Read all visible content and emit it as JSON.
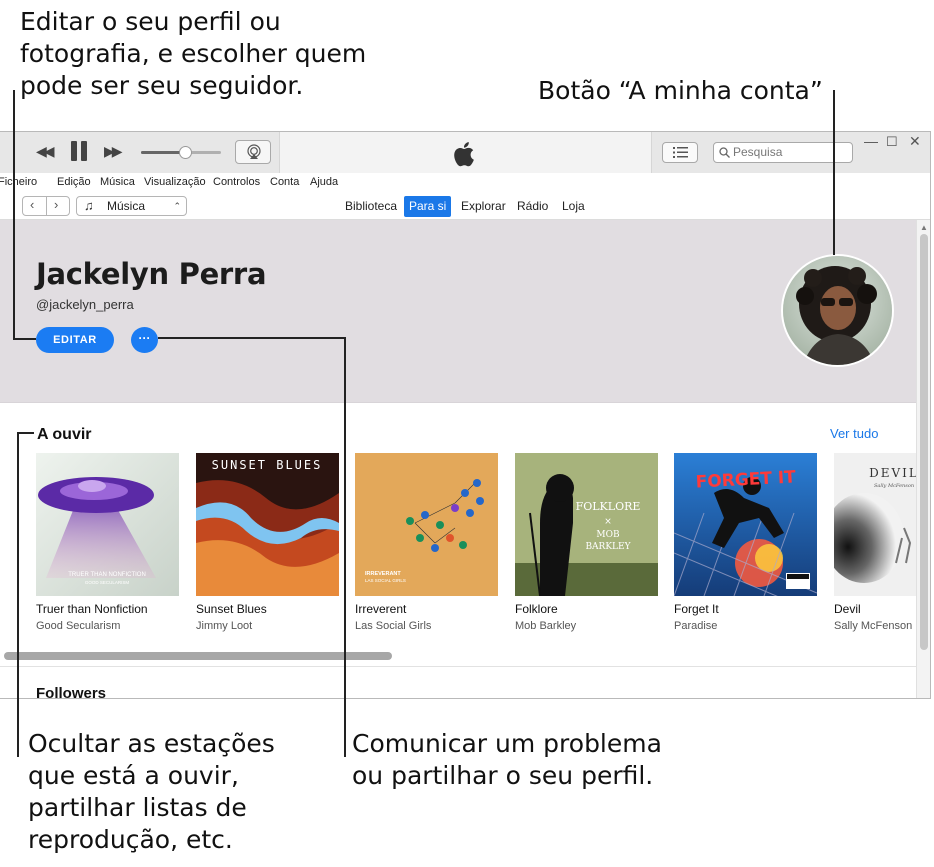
{
  "callouts": {
    "profile_edit": "Editar o seu perfil ou\nfotografia, e escolher quem\npode ser seu seguidor.",
    "account_button": "Botão “A minha conta”",
    "hide_stations": "Ocultar as estações\nque está a ouvir,\npartilhar listas de\nreprodução, etc.",
    "report_share": "Comunicar um problema\nou partilhar o seu perfil."
  },
  "window": {
    "search_placeholder": "Pesquisa",
    "menu": [
      "Ficheiro",
      "Edição",
      "Música",
      "Visualização",
      "Controlos",
      "Conta",
      "Ajuda"
    ],
    "source_label": "Música",
    "tabs": [
      "Biblioteca",
      "Para si",
      "Explorar",
      "Rádio",
      "Loja"
    ],
    "active_tab": "Para si",
    "volume_level": 0.55
  },
  "profile": {
    "name": "Jackelyn Perra",
    "handle": "@jackelyn_perra",
    "edit_label": "EDITAR",
    "more_label": "···"
  },
  "listening": {
    "title": "A ouvir",
    "see_all": "Ver tudo",
    "albums": [
      {
        "title": "Truer than Nonfiction",
        "artist": "Good Secularism",
        "cover_text": "TRUER THAN NONFICTION\nGOOD SECULARISM"
      },
      {
        "title": "Sunset Blues",
        "artist": "Jimmy Loot",
        "cover_text": "SUNSET BLUES"
      },
      {
        "title": "Irreverent",
        "artist": "Las Social Girls",
        "cover_text": "IRREVERANT\nLAS SOCIAL GIRLS"
      },
      {
        "title": "Folklore",
        "artist": "Mob Barkley",
        "cover_text": "FOLKLORE\n×\nMOB\nBARKLEY"
      },
      {
        "title": "Forget It",
        "artist": "Paradise",
        "cover_text": "FORGET IT"
      },
      {
        "title": "Devil",
        "artist": "Sally McFenson",
        "cover_text": "DEVIL\nSally McFenson"
      }
    ]
  },
  "followers_title": "Followers",
  "colors": {
    "accent": "#1b7cf3",
    "profile_bg": "#e1dde1",
    "link": "#1a78e8"
  }
}
